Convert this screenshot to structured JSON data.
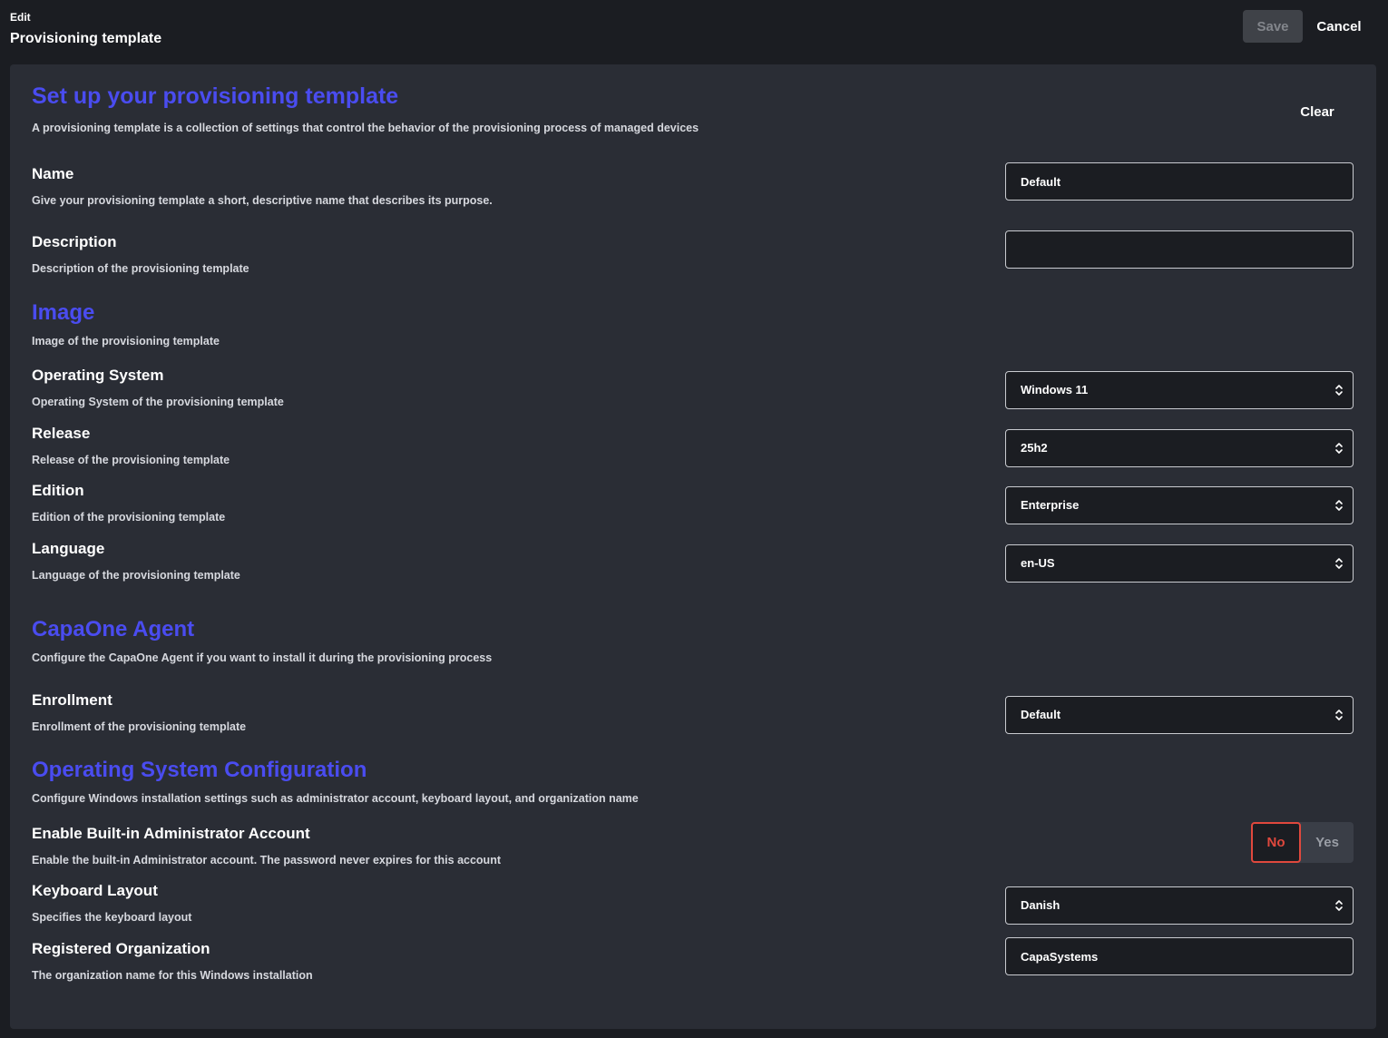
{
  "header": {
    "edit_label": "Edit",
    "title": "Provisioning template",
    "save_label": "Save",
    "cancel_label": "Cancel"
  },
  "intro": {
    "title": "Set up your provisioning template",
    "description": "A provisioning template is a collection of settings that control the behavior of the provisioning process of managed devices",
    "clear_label": "Clear"
  },
  "general": {
    "name": {
      "label": "Name",
      "description": "Give your provisioning template a short, descriptive name that describes its purpose.",
      "value": "Default"
    },
    "description": {
      "label": "Description",
      "description": "Description of the provisioning template",
      "value": ""
    }
  },
  "image": {
    "title": "Image",
    "description": "Image of the provisioning template",
    "operating_system": {
      "label": "Operating System",
      "description": "Operating System of the provisioning template",
      "value": "Windows 11"
    },
    "release": {
      "label": "Release",
      "description": "Release of the provisioning template",
      "value": "25h2"
    },
    "edition": {
      "label": "Edition",
      "description": "Edition of the provisioning template",
      "value": "Enterprise"
    },
    "language": {
      "label": "Language",
      "description": "Language of the provisioning template",
      "value": "en-US"
    }
  },
  "agent": {
    "title": "CapaOne Agent",
    "description": "Configure the CapaOne Agent if you want to install it during the provisioning process",
    "enrollment": {
      "label": "Enrollment",
      "description": "Enrollment of the provisioning template",
      "value": "Default"
    }
  },
  "os_config": {
    "title": "Operating System Configuration",
    "description": "Configure Windows installation settings such as administrator account, keyboard layout, and organization name",
    "admin_account": {
      "label": "Enable Built-in Administrator Account",
      "description": "Enable the built-in Administrator account. The password never expires for this account",
      "option_no": "No",
      "option_yes": "Yes",
      "selected": "No"
    },
    "keyboard_layout": {
      "label": "Keyboard Layout",
      "description": "Specifies the keyboard layout",
      "value": "Danish"
    },
    "organization": {
      "label": "Registered Organization",
      "description": "The organization name for this Windows installation",
      "value": "CapaSystems"
    }
  },
  "colors": {
    "accent": "#4a4cf0",
    "background": "#1b1d22",
    "panel": "#2a2d35",
    "toggle_selected": "#e0483d"
  },
  "icons": {
    "select_chevron": "chevron-up-down-icon"
  }
}
